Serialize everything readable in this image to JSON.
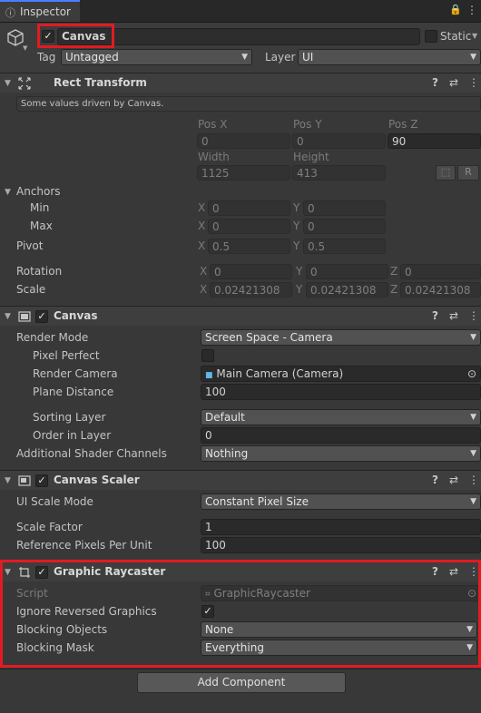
{
  "tab": {
    "label": "Inspector"
  },
  "object": {
    "name": "Canvas",
    "static_label": "Static",
    "tag_label": "Tag",
    "tag_value": "Untagged",
    "layer_label": "Layer",
    "layer_value": "UI"
  },
  "rect_transform": {
    "title": "Rect Transform",
    "notice": "Some values driven by Canvas.",
    "pos_x_label": "Pos X",
    "pos_y_label": "Pos Y",
    "pos_z_label": "Pos Z",
    "pos_x": "0",
    "pos_y": "0",
    "pos_z": "90",
    "width_label": "Width",
    "height_label": "Height",
    "width": "1125",
    "height": "413",
    "r_button": "R",
    "anchors_label": "Anchors",
    "min_label": "Min",
    "max_label": "Max",
    "min_x": "0",
    "min_y": "0",
    "max_x": "0",
    "max_y": "0",
    "pivot_label": "Pivot",
    "pivot_x": "0.5",
    "pivot_y": "0.5",
    "rotation_label": "Rotation",
    "rot_x": "0",
    "rot_y": "0",
    "rot_z": "0",
    "scale_label": "Scale",
    "scale_x": "0.02421308",
    "scale_y": "0.02421308",
    "scale_z": "0.02421308",
    "axis_x": "X",
    "axis_y": "Y",
    "axis_z": "Z"
  },
  "canvas": {
    "title": "Canvas",
    "render_mode_label": "Render Mode",
    "render_mode": "Screen Space - Camera",
    "pixel_perfect_label": "Pixel Perfect",
    "render_camera_label": "Render Camera",
    "render_camera": "Main Camera (Camera)",
    "plane_distance_label": "Plane Distance",
    "plane_distance": "100",
    "sorting_layer_label": "Sorting Layer",
    "sorting_layer": "Default",
    "order_in_layer_label": "Order in Layer",
    "order_in_layer": "0",
    "shader_channels_label": "Additional Shader Channels",
    "shader_channels": "Nothing"
  },
  "canvas_scaler": {
    "title": "Canvas Scaler",
    "ui_scale_mode_label": "UI Scale Mode",
    "ui_scale_mode": "Constant Pixel Size",
    "scale_factor_label": "Scale Factor",
    "scale_factor": "1",
    "ref_ppu_label": "Reference Pixels Per Unit",
    "ref_ppu": "100"
  },
  "graphic_raycaster": {
    "title": "Graphic Raycaster",
    "script_label": "Script",
    "script": "GraphicRaycaster",
    "ignore_reversed_label": "Ignore Reversed Graphics",
    "blocking_objects_label": "Blocking Objects",
    "blocking_objects": "None",
    "blocking_mask_label": "Blocking Mask",
    "blocking_mask": "Everything"
  },
  "add_component": "Add Component",
  "icons": {
    "lock": "🔒",
    "menu": "⋮",
    "help": "?",
    "presets": "⇄",
    "check": "✓",
    "fold_down": "▼",
    "dropdown": "▼",
    "target": "⊙",
    "camera": "📹"
  },
  "colors": {
    "highlight": "#e21b22",
    "background": "#383838",
    "header": "#3e3e3e"
  }
}
